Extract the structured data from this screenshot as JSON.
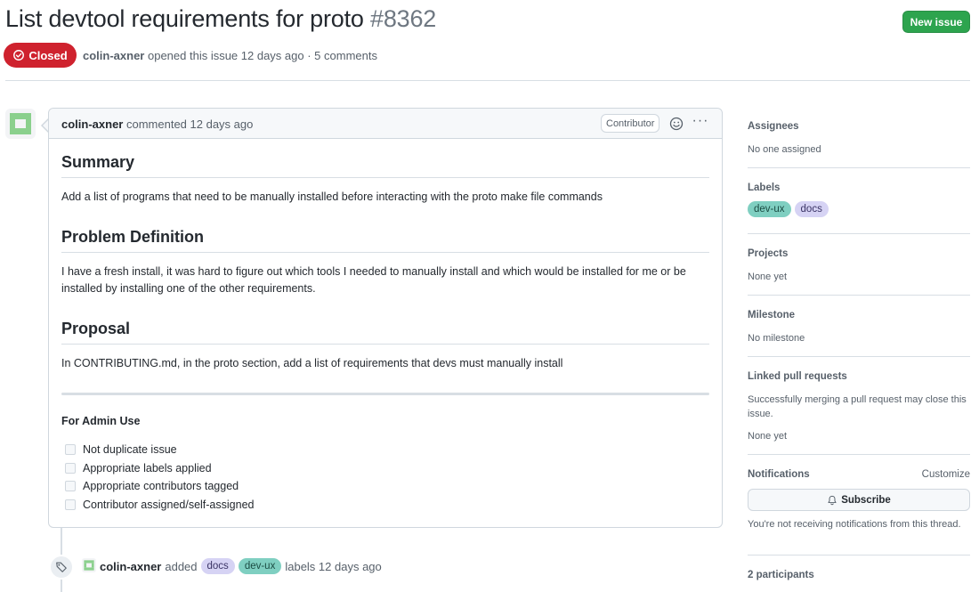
{
  "issue": {
    "title": "List devtool requirements for proto",
    "number": "#8362",
    "state": "Closed",
    "author": "colin-axner",
    "meta": "opened this issue 12 days ago · 5 comments",
    "new_issue_label": "New issue"
  },
  "comment": {
    "author": "colin-axner",
    "time": "commented 12 days ago",
    "badge": "Contributor",
    "sections": [
      {
        "heading": "Summary",
        "body": "Add a list of programs that need to be manually installed before interacting with the proto make file commands"
      },
      {
        "heading": "Problem Definition",
        "body": "I have a fresh install, it was hard to figure out which tools I needed to manually install and which would be installed for me or be installed by installing one of the other requirements."
      },
      {
        "heading": "Proposal",
        "body": "In CONTRIBUTING.md, in the proto section, add a list of requirements that devs must manually install"
      }
    ],
    "admin_heading": "For Admin Use",
    "tasks": [
      "Not duplicate issue",
      "Appropriate labels applied",
      "Appropriate contributors tagged",
      "Contributor assigned/self-assigned"
    ]
  },
  "event": {
    "actor": "colin-axner",
    "action": "added",
    "labels": [
      "docs",
      "dev-ux"
    ],
    "suffix": "labels 12 days ago"
  },
  "sidebar": {
    "assignees": {
      "title": "Assignees",
      "value": "No one assigned"
    },
    "labels": {
      "title": "Labels",
      "items": [
        "dev-ux",
        "docs"
      ]
    },
    "projects": {
      "title": "Projects",
      "value": "None yet"
    },
    "milestone": {
      "title": "Milestone",
      "value": "No milestone"
    },
    "linked": {
      "title": "Linked pull requests",
      "description": "Successfully merging a pull request may close this issue.",
      "value": "None yet"
    },
    "notifications": {
      "title": "Notifications",
      "customize": "Customize",
      "subscribe_label": "Subscribe",
      "note": "You're not receiving notifications from this thread."
    },
    "participants": "2 participants"
  },
  "colors": {
    "closed": "#cf222e",
    "primary_button": "#2da44e",
    "label_devux": "#7fcfc1",
    "label_docs": "#d6d3f4"
  },
  "icons": [
    "issue-closed-icon",
    "smiley-icon",
    "kebab-horizontal-icon",
    "tag-icon",
    "bell-icon"
  ]
}
